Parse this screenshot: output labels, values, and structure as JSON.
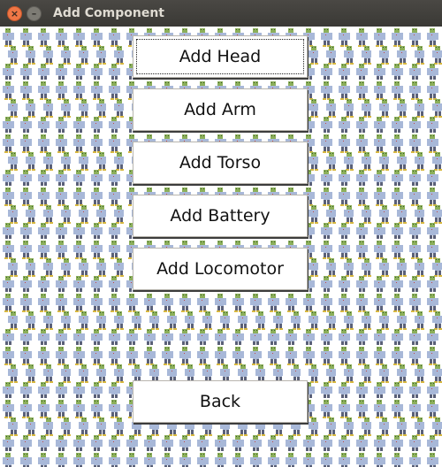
{
  "window": {
    "title": "Add Component",
    "close_glyph": "×",
    "minimize_glyph": "–"
  },
  "buttons": {
    "add_head": "Add Head",
    "add_arm": "Add Arm",
    "add_torso": "Add Torso",
    "add_battery": "Add Battery",
    "add_locomotor": "Add Locomotor",
    "back": "Back"
  },
  "colors": {
    "titlebar": "#3c3b37",
    "close_button": "#f07746",
    "robot_body": "#a8b8d8",
    "robot_head": "#8cb05a",
    "robot_legs": "#5a6078",
    "robot_feet": "#d8b840"
  }
}
